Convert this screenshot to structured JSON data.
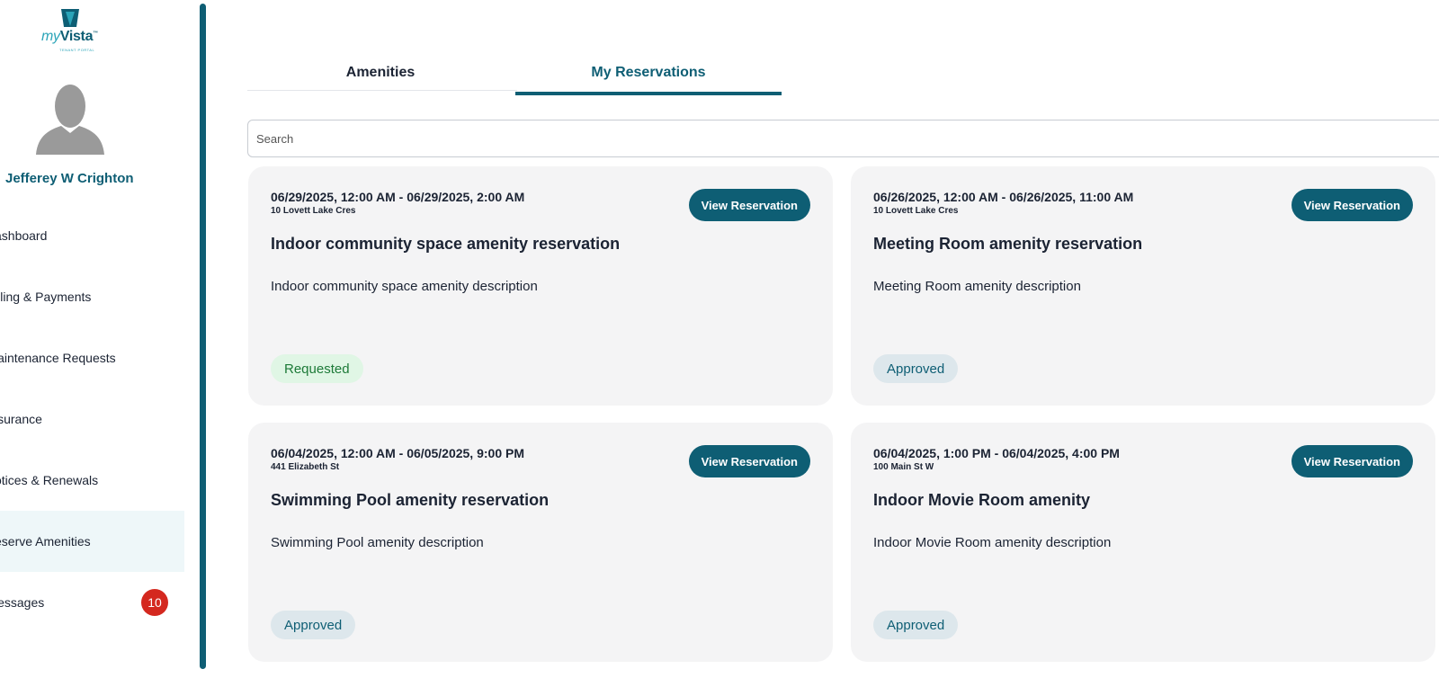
{
  "brand": {
    "logo_primary": "my",
    "logo_secondary": "Vista",
    "logo_tm": "™",
    "logo_sub": "TENANT PORTAL",
    "accent_color": "#0e5e74"
  },
  "user": {
    "name": "Jefferey W Crighton",
    "avatar_icon": "user-silhouette-icon"
  },
  "sidebar": {
    "items": [
      {
        "label": "ashboard"
      },
      {
        "label": "illing & Payments"
      },
      {
        "label": "laintenance Requests"
      },
      {
        "label": "isurance"
      },
      {
        "label": "otices & Renewals"
      },
      {
        "label": "eserve Amenities",
        "active": true
      },
      {
        "label": "lessages",
        "badge": "10"
      }
    ]
  },
  "tabs": [
    {
      "label": "Amenities"
    },
    {
      "label": "My Reservations",
      "active": true
    }
  ],
  "search": {
    "placeholder": "Search"
  },
  "reservations": [
    {
      "dates": "06/29/2025, 12:00 AM - 06/29/2025, 2:00 AM",
      "address": "10 Lovett Lake Cres",
      "title": "Indoor community space amenity reservation",
      "description": "Indoor community space amenity description",
      "status": "Requested",
      "button": "View Reservation"
    },
    {
      "dates": "06/26/2025, 12:00 AM - 06/26/2025, 11:00 AM",
      "address": "10 Lovett Lake Cres",
      "title": "Meeting Room amenity reservation",
      "description": "Meeting Room amenity description",
      "status": "Approved",
      "button": "View Reservation"
    },
    {
      "dates": "06/04/2025, 12:00 AM - 06/05/2025, 9:00 PM",
      "address": "441 Elizabeth St",
      "title": "Swimming Pool amenity reservation",
      "description": "Swimming Pool amenity description",
      "status": "Approved",
      "button": "View Reservation"
    },
    {
      "dates": "06/04/2025, 1:00 PM - 06/04/2025, 4:00 PM",
      "address": "100 Main St W",
      "title": "Indoor Movie Room amenity",
      "description": "Indoor Movie Room amenity description",
      "status": "Approved",
      "button": "View Reservation"
    }
  ]
}
